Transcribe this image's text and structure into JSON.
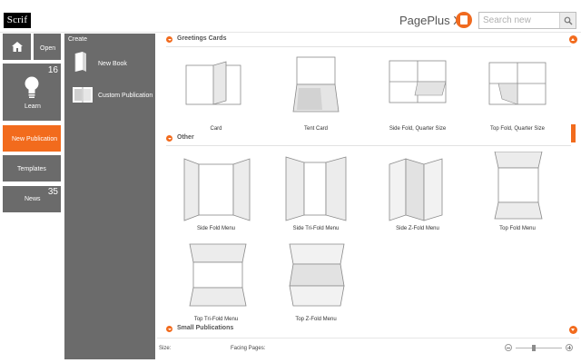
{
  "header": {
    "logo": "Scrif",
    "app_title": "PagePlus X8",
    "search_placeholder": "Search new"
  },
  "nav": {
    "open": "Open",
    "learn": {
      "label": "Learn",
      "count": "16"
    },
    "new_publication": "New Publication",
    "templates": "Templates",
    "news": {
      "label": "News",
      "count": "35"
    }
  },
  "create": {
    "heading": "Create",
    "new_book": "New Book",
    "custom_publication": "Custom Publication"
  },
  "sections": {
    "greeting": {
      "title": "Greetings Cards",
      "items": [
        "Card",
        "Tent Card",
        "Side Fold, Quarter Size",
        "Top Fold, Quarter Size"
      ]
    },
    "other": {
      "title": "Other",
      "items": [
        "Side Fold Menu",
        "Side Tri-Fold Menu",
        "Side Z-Fold Menu",
        "Top Fold Menu",
        "Top Tri-Fold Menu",
        "Top Z-Fold Menu"
      ]
    },
    "small": {
      "title": "Small Publications"
    }
  },
  "footer": {
    "size_label": "Size:",
    "facing_label": "Facing Pages:",
    "zoom_level": 0.4
  },
  "colors": {
    "accent": "#f26b1d",
    "panel": "#6b6b6b",
    "header_text": "#555555"
  }
}
